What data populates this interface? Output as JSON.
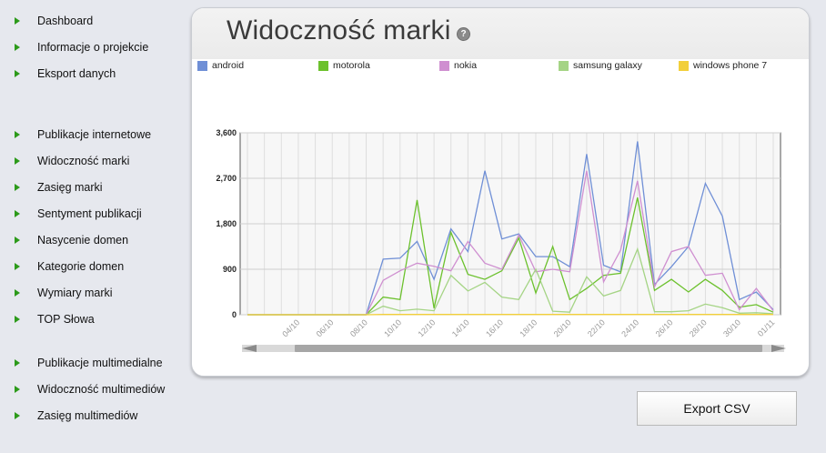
{
  "sidebar": {
    "items": [
      {
        "label": "Dashboard"
      },
      {
        "label": "Informacje o projekcie"
      },
      {
        "label": "Eksport danych"
      },
      {
        "label": "Publikacje internetowe"
      },
      {
        "label": "Widoczność marki"
      },
      {
        "label": "Zasięg marki"
      },
      {
        "label": "Sentyment publikacji"
      },
      {
        "label": "Nasycenie domen"
      },
      {
        "label": "Kategorie domen"
      },
      {
        "label": "Wymiary marki"
      },
      {
        "label": "TOP Słowa"
      },
      {
        "label": "Publikacje multimedialne"
      },
      {
        "label": "Widoczność multimediów"
      },
      {
        "label": "Zasięg multimediów"
      }
    ]
  },
  "page": {
    "title": "Widoczność marki",
    "help_icon": "question-mark-icon"
  },
  "export": {
    "label": "Export CSV"
  },
  "colors": {
    "android": "#6f8fd6",
    "motorola": "#6cc12d",
    "nokia": "#cf8fd0",
    "samsung": "#a5d485",
    "windows": "#f2cf3a",
    "bullet": "#2c9a1a"
  },
  "chart_data": {
    "type": "line",
    "x_tick_labels": [
      "04/10",
      "06/10",
      "08/10",
      "10/10",
      "12/10",
      "14/10",
      "16/10",
      "18/10",
      "20/10",
      "22/10",
      "24/10",
      "26/10",
      "28/10",
      "30/10",
      "01/11"
    ],
    "x": [
      "01/10",
      "02/10",
      "03/10",
      "04/10",
      "05/10",
      "06/10",
      "07/10",
      "08/10",
      "09/10",
      "10/10",
      "11/10",
      "12/10",
      "13/10",
      "14/10",
      "15/10",
      "16/10",
      "17/10",
      "18/10",
      "19/10",
      "20/10",
      "21/10",
      "22/10",
      "23/10",
      "24/10",
      "25/10",
      "26/10",
      "27/10",
      "28/10",
      "29/10",
      "30/10",
      "31/10",
      "01/11"
    ],
    "ylim": [
      0,
      3600
    ],
    "y_ticks": [
      "0",
      "900",
      "1,800",
      "2,700",
      "3,600"
    ],
    "grid": true,
    "legend_position": "top",
    "series": [
      {
        "name": "android",
        "color_key": "android",
        "values": [
          0,
          0,
          0,
          0,
          0,
          0,
          0,
          0,
          1100,
          1120,
          1450,
          700,
          1700,
          1250,
          2850,
          1500,
          1600,
          1150,
          1150,
          950,
          3180,
          980,
          850,
          3430,
          600,
          950,
          1350,
          2600,
          1950,
          300,
          450,
          100
        ]
      },
      {
        "name": "motorola",
        "color_key": "motorola",
        "values": [
          0,
          0,
          0,
          0,
          0,
          0,
          0,
          0,
          350,
          300,
          2270,
          130,
          1630,
          800,
          700,
          870,
          1520,
          430,
          1350,
          300,
          520,
          780,
          820,
          2320,
          480,
          700,
          450,
          700,
          480,
          150,
          200,
          50
        ]
      },
      {
        "name": "nokia",
        "color_key": "nokia",
        "values": [
          0,
          0,
          0,
          0,
          0,
          0,
          0,
          0,
          680,
          870,
          1020,
          960,
          870,
          1450,
          1020,
          900,
          1580,
          850,
          900,
          850,
          2850,
          650,
          1280,
          2650,
          550,
          1250,
          1350,
          780,
          820,
          100,
          520,
          80
        ]
      },
      {
        "name": "samsung galaxy",
        "color_key": "samsung",
        "values": [
          0,
          0,
          0,
          0,
          0,
          0,
          0,
          0,
          170,
          80,
          110,
          80,
          780,
          470,
          640,
          350,
          300,
          900,
          70,
          50,
          750,
          370,
          480,
          1300,
          60,
          60,
          80,
          210,
          140,
          30,
          40,
          20
        ]
      },
      {
        "name": "windows phone 7",
        "color_key": "windows",
        "values": [
          0,
          0,
          0,
          0,
          0,
          0,
          0,
          0,
          5,
          5,
          5,
          5,
          5,
          5,
          5,
          5,
          5,
          5,
          5,
          5,
          5,
          5,
          5,
          5,
          5,
          5,
          5,
          5,
          5,
          5,
          5,
          5
        ]
      }
    ]
  }
}
